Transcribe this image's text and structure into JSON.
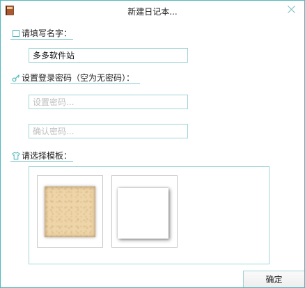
{
  "window": {
    "title": "新建日记本...",
    "accent_color": "#4fb8bd",
    "icons": {
      "app": "diary-book-icon",
      "close": "close-icon"
    }
  },
  "name_section": {
    "label": "请填写名字：",
    "icon": "checkbox-square-icon",
    "value": "多多软件站",
    "placeholder": ""
  },
  "password_section": {
    "label": "设置登录密码（空为无密码）：",
    "icon": "key-icon",
    "password_placeholder": "设置密码...",
    "confirm_placeholder": "确认密码..."
  },
  "template_section": {
    "label": "请选择模板：",
    "icon": "shirt-icon",
    "templates": [
      {
        "name": "paper-template",
        "style": "parchment"
      },
      {
        "name": "white-template",
        "style": "plain-white"
      }
    ]
  },
  "footer": {
    "ok_label": "确定"
  }
}
